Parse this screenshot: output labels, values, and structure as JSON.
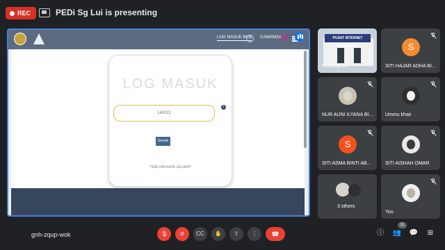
{
  "topbar": {
    "rec_label": "REC",
    "presenting_text": "PEDi Sg Lui is presenting"
  },
  "shared_screen": {
    "nav": {
      "login_link": "LOG MASUK BKM",
      "help": "?",
      "branch_link": "CAWANGAN"
    },
    "login": {
      "title": "LOG MASUK",
      "input_value": "140022",
      "help_dot": "i",
      "submit_label": "Semak",
      "forgot_link": "TERLUPA KATA LALUAN?"
    }
  },
  "participants": [
    {
      "name": "PEDi Sg Lui",
      "type": "camera",
      "sign_text": "PUSAT INTERNET KOMUNITI"
    },
    {
      "name": "SITI HAJAR ADHA BI...",
      "type": "avatar",
      "initial": "S",
      "color": "#f28b32",
      "muted": true
    },
    {
      "name": "NUR AUNI ILYANA BI...",
      "type": "photo",
      "muted": true
    },
    {
      "name": "Ummu khair",
      "type": "photo",
      "muted": true
    },
    {
      "name": "SITI ASMA BINTI AB...",
      "type": "avatar",
      "initial": "S",
      "color": "#f4511e",
      "muted": true
    },
    {
      "name": "SITI AISHAH OMAR",
      "type": "photo",
      "muted": true
    },
    {
      "name": "3 others",
      "type": "group"
    },
    {
      "name": "You",
      "type": "photo",
      "muted": true
    }
  ],
  "bottombar": {
    "meeting_code": "gnh-zqup-wok",
    "participant_count": "11",
    "accent_red": "#ea4335"
  }
}
